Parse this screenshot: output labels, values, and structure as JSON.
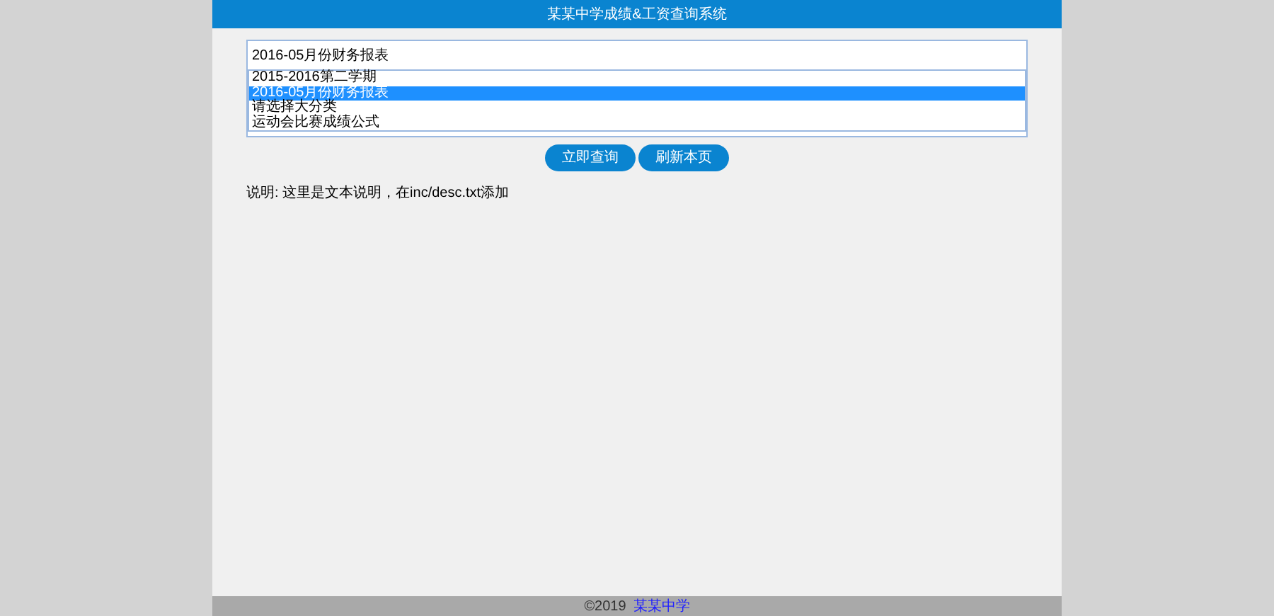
{
  "header": {
    "title": "某某中学成绩&工资查询系统"
  },
  "select": {
    "value": "2016-05月份财务报表",
    "options": [
      {
        "label": "2015-2016第二学期",
        "selected": false
      },
      {
        "label": "2016-05月份财务报表",
        "selected": true
      },
      {
        "label": "请选择大分类",
        "selected": false
      },
      {
        "label": "运动会比赛成绩公式",
        "selected": false
      }
    ]
  },
  "buttons": [
    "立即查询",
    "刷新本页"
  ],
  "description": "说明: 这里是文本说明，在inc/desc.txt添加",
  "footer": {
    "copyright": "©2019",
    "link": "某某中学"
  }
}
